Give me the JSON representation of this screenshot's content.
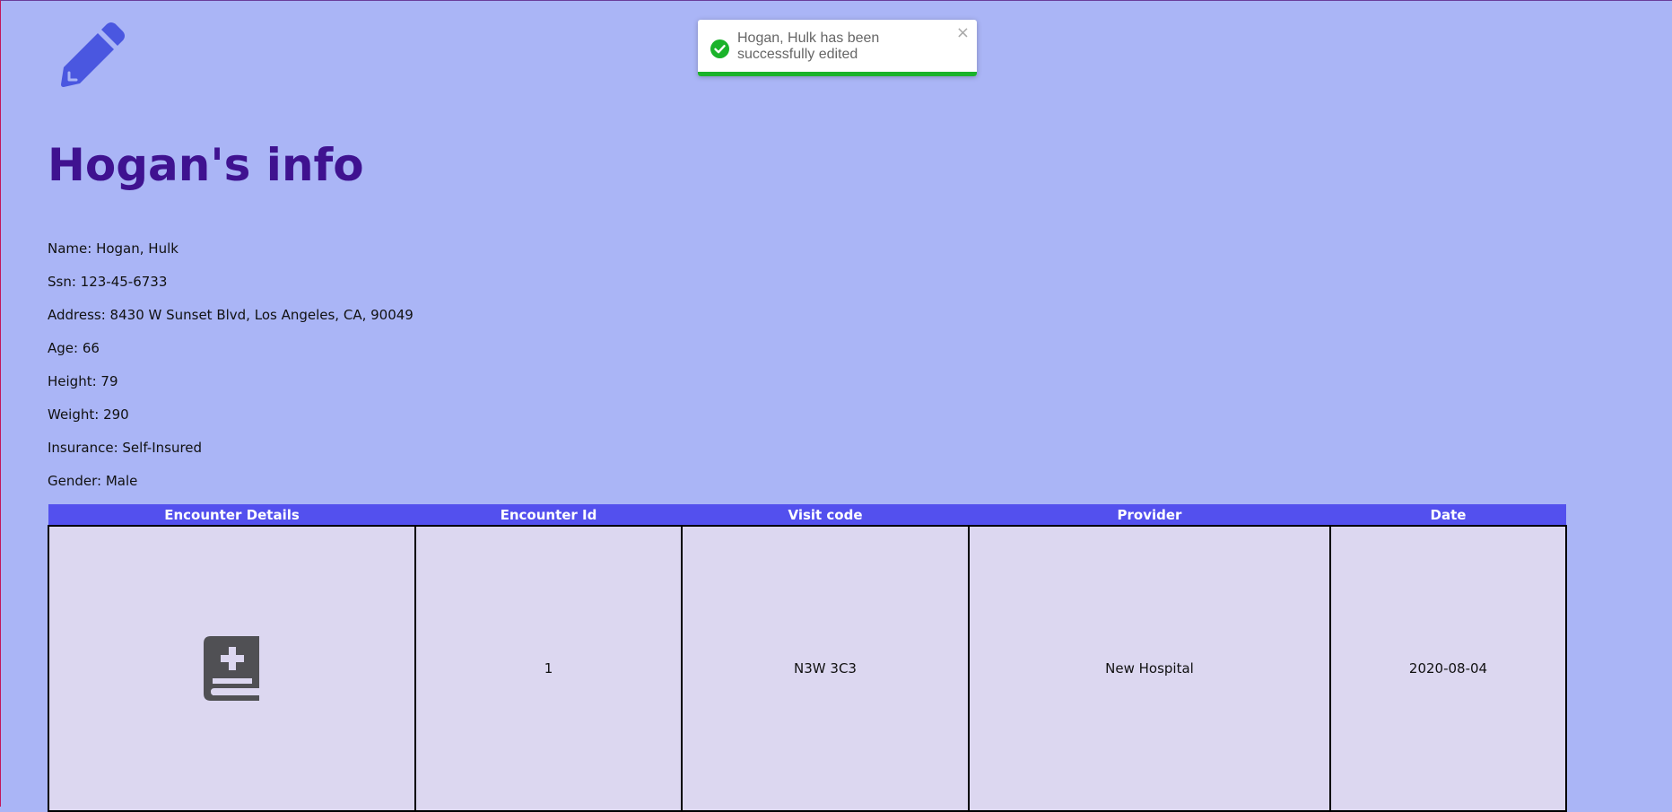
{
  "header": {
    "icon": "pencil-icon",
    "title": "Hogan's info"
  },
  "patient": {
    "name": "Name: Hogan, Hulk",
    "ssn": "Ssn: 123-45-6733",
    "address": "Address: 8430 W Sunset Blvd, Los Angeles, CA, 90049",
    "age": "Age: 66",
    "height": "Height: 79",
    "weight": "Weight: 290",
    "insurance": "Insurance: Self-Insured",
    "gender": "Gender: Male"
  },
  "encounters": {
    "columns": [
      "Encounter Details",
      "Encounter Id",
      "Visit code",
      "Provider",
      "Date"
    ],
    "rows": [
      {
        "details_icon": "medical-book-icon",
        "id": "1",
        "visit_code": "N3W 3C3",
        "provider": "New Hospital",
        "date": "2020-08-04"
      }
    ]
  },
  "toast": {
    "message": "Hogan, Hulk has been successfully edited",
    "close_label": "×",
    "check_icon": "check-circle-icon",
    "progress": 1.0
  },
  "colors": {
    "background": "#aab5f6",
    "title": "#3f1290",
    "header_row": "#5350ee",
    "cell": "#dcd7f0",
    "accent_icon": "#4a57e0",
    "success": "#1ab32a"
  }
}
